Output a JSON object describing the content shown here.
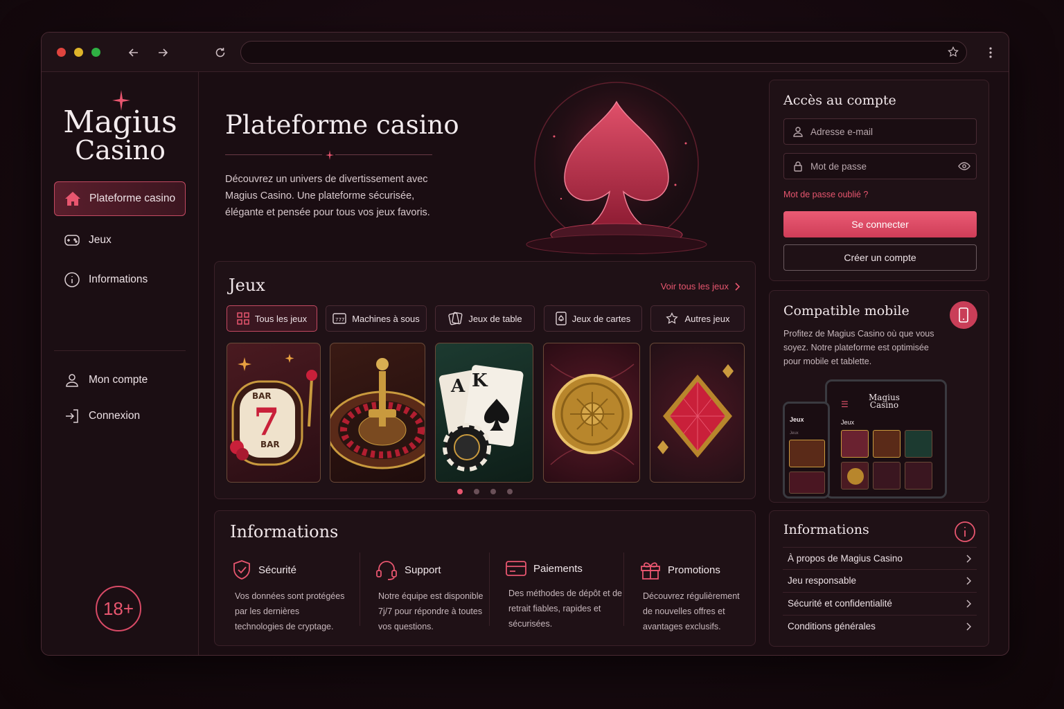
{
  "browser": {
    "url": ""
  },
  "sidebar": {
    "logo_line1": "Magius",
    "logo_line2": "Casino",
    "nav": [
      {
        "label": "Plateforme casino",
        "icon": "home-icon",
        "active": true
      },
      {
        "label": "Jeux",
        "icon": "gamepad-icon",
        "active": false
      },
      {
        "label": "Informations",
        "icon": "info-icon",
        "active": false
      }
    ],
    "account_nav": [
      {
        "label": "Mon compte",
        "icon": "user-icon"
      },
      {
        "label": "Connexion",
        "icon": "login-icon"
      }
    ],
    "age_badge": "18+"
  },
  "hero": {
    "title": "Plateforme casino",
    "text": "Découvrez un univers de divertissement avec Magius Casino. Une plateforme sécurisée, élégante et pensée pour tous vos jeux favoris."
  },
  "games": {
    "title": "Jeux",
    "see_all": "Voir tous les jeux",
    "tabs": [
      {
        "label": "Tous les jeux",
        "icon": "grid-icon",
        "active": true
      },
      {
        "label": "Machines à sous",
        "icon": "slot-icon",
        "active": false
      },
      {
        "label": "Jeux de table",
        "icon": "table-icon",
        "active": false
      },
      {
        "label": "Jeux de cartes",
        "icon": "card-icon",
        "active": false
      },
      {
        "label": "Autres jeux",
        "icon": "star-icon",
        "active": false
      }
    ],
    "cards": [
      "slot-machine",
      "roulette",
      "cards-and-chip",
      "gold-coin",
      "red-diamond"
    ],
    "pagination_pages": 4,
    "pagination_active": 1
  },
  "informations": {
    "title": "Informations",
    "items": [
      {
        "title": "Sécurité",
        "icon": "shield-icon",
        "text": "Vos données sont protégées par les dernières technologies de cryptage."
      },
      {
        "title": "Support",
        "icon": "headset-icon",
        "text": "Notre équipe est disponible 7j/7 pour répondre à toutes vos questions."
      },
      {
        "title": "Paiements",
        "icon": "credit-card-icon",
        "text": "Des méthodes de dépôt et de retrait fiables, rapides et sécurisées."
      },
      {
        "title": "Promotions",
        "icon": "gift-icon",
        "text": "Découvrez régulièrement de nouvelles offres et avantages exclusifs."
      }
    ]
  },
  "account": {
    "title": "Accès au compte",
    "email_placeholder": "Adresse e-mail",
    "password_placeholder": "Mot de passe",
    "forgot": "Mot de passe oublié ?",
    "login": "Se connecter",
    "create": "Créer un compte"
  },
  "mobile": {
    "title": "Compatible mobile",
    "text": "Profitez de Magius Casino où que vous soyez. Notre plateforme est optimisée pour mobile et tablette.",
    "phone_label": "Jeux",
    "phone_sub": "Jeux",
    "tablet_logo1": "Magius",
    "tablet_logo2": "Casino",
    "tablet_label": "Jeux"
  },
  "info_links": {
    "title": "Informations",
    "links": [
      "À propos de Magius Casino",
      "Jeu responsable",
      "Sécurité et confidentialité",
      "Conditions générales"
    ]
  },
  "colors": {
    "accent": "#e8566f",
    "background": "#1a0d12",
    "panel": "#1f1116",
    "gold": "#c99a3e"
  }
}
